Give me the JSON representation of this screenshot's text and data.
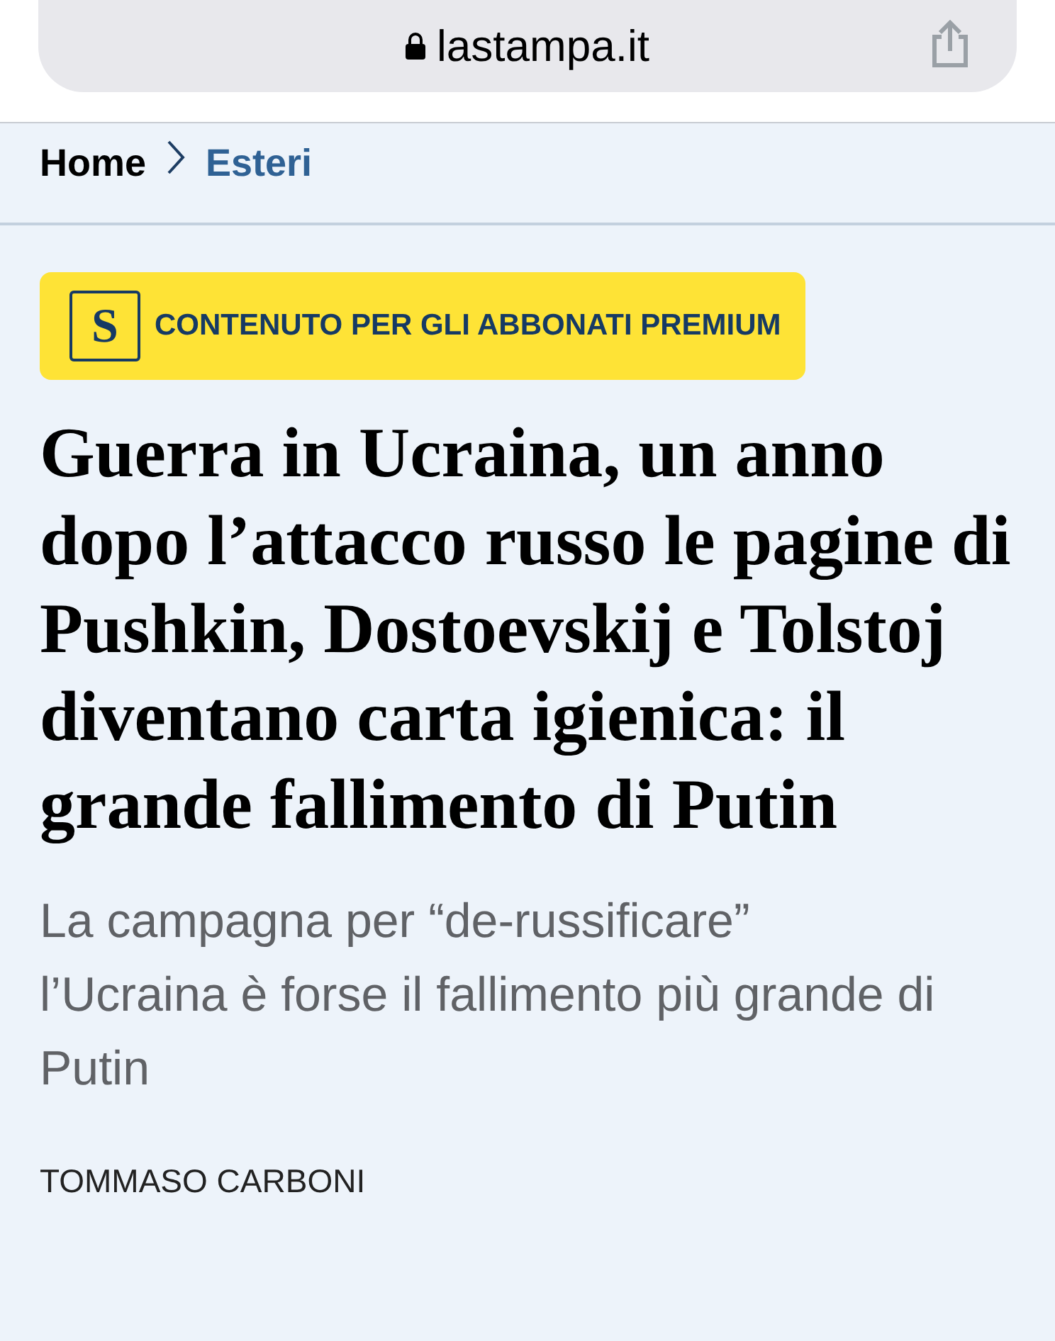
{
  "browser": {
    "url": "lastampa.it"
  },
  "breadcrumb": [
    {
      "label": "Home",
      "selected": false
    },
    {
      "label": "Esteri",
      "selected": true
    }
  ],
  "badge": {
    "logo_letter": "S",
    "label": "CONTENUTO PER GLI ABBONATI PREMIUM"
  },
  "headline": "Guerra in Ucraina, un anno dopo l’attacco russo le pagine di Pushkin, Dostoevskij e Tolstoj diventano carta igienica: il grande fallimento di Putin",
  "subtitle": "La campagna per “de-russificare” l’Ucraina è forse il fallimento più grande di Putin",
  "author": "TOMMASO CARBONI"
}
